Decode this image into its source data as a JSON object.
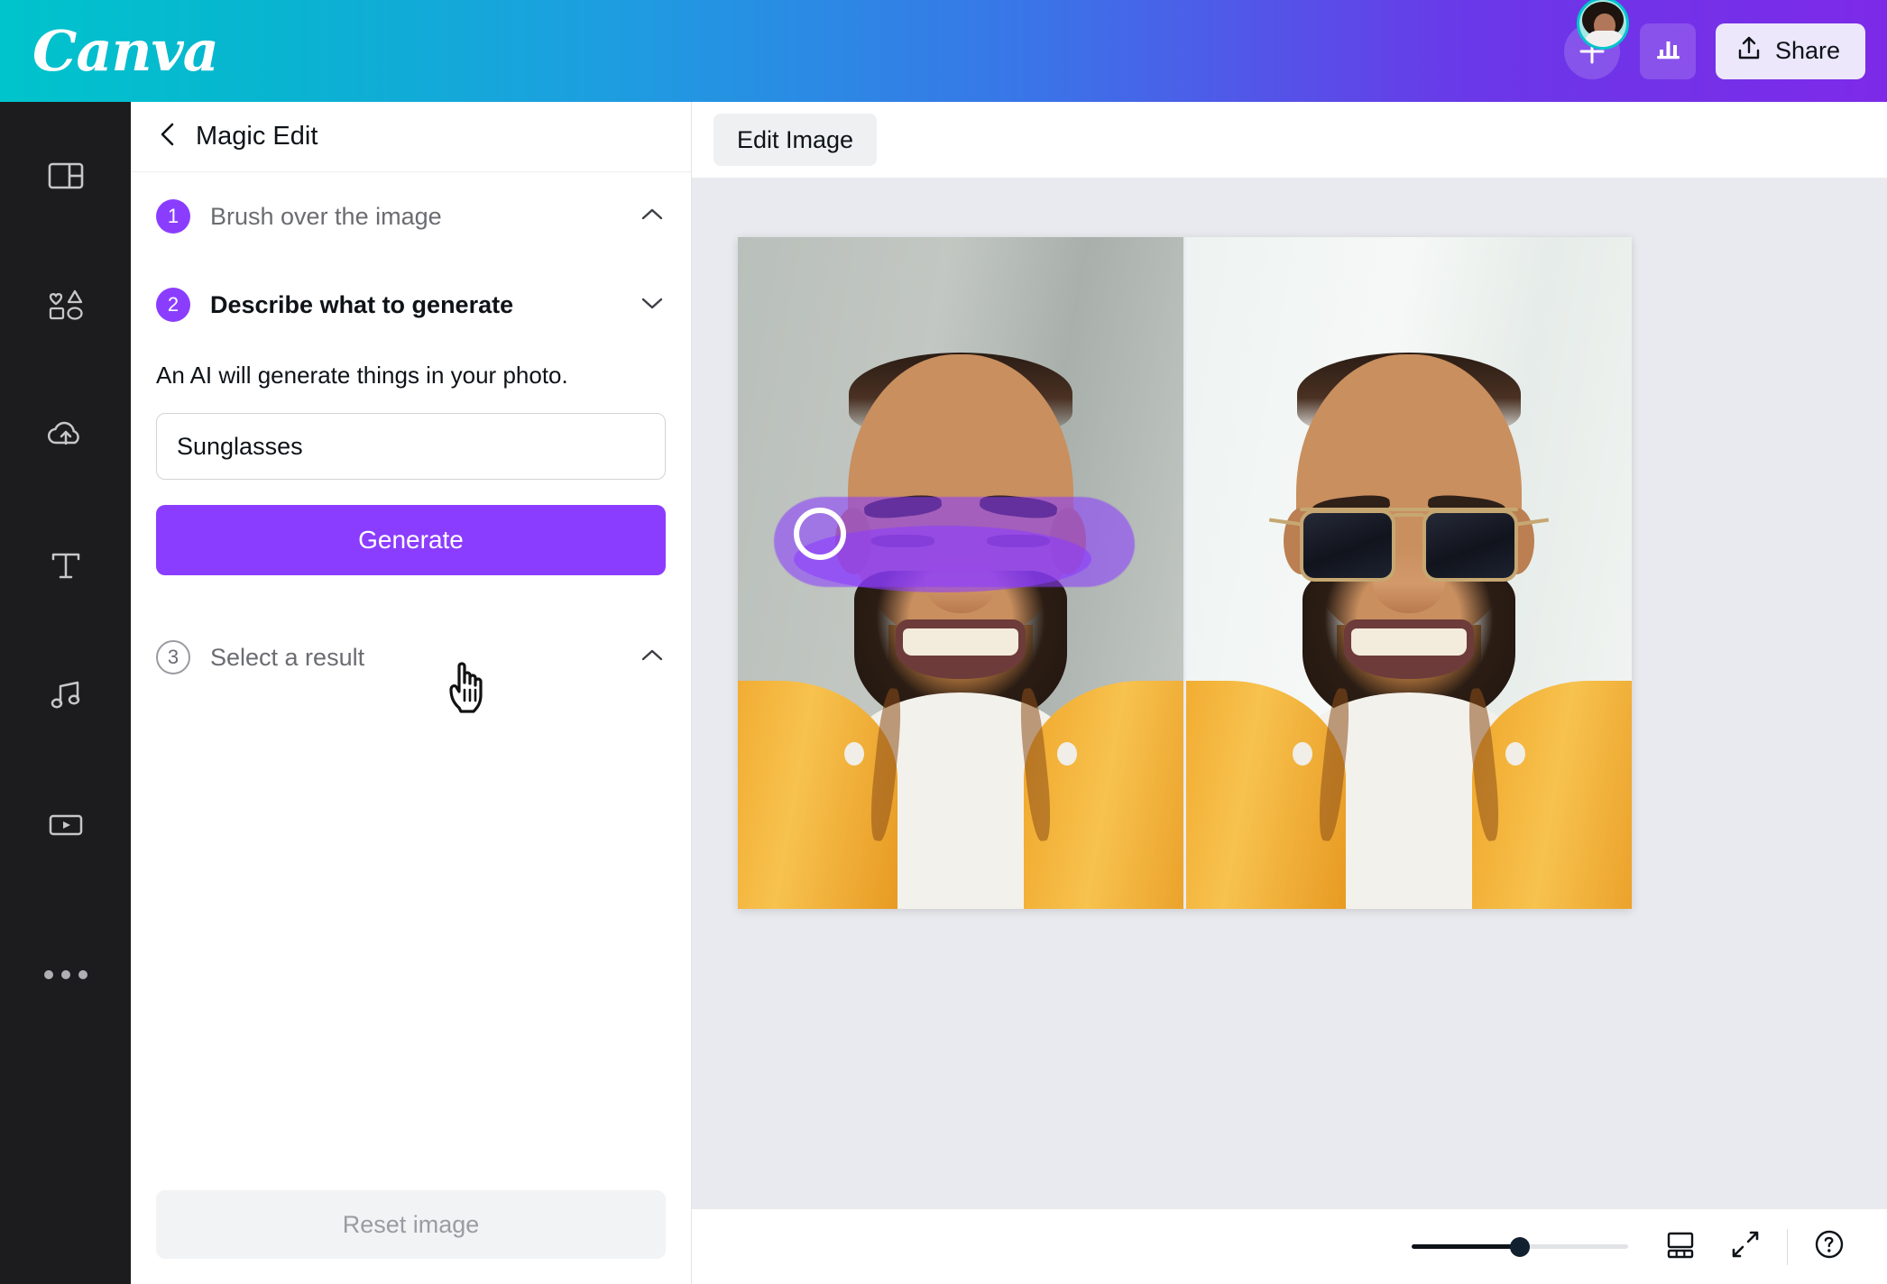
{
  "header": {
    "logo_text": "Canva",
    "gradient_start": "#00c4cc",
    "gradient_end": "#7d2ae8",
    "avatar_name": "avatar",
    "add_button_label": "+",
    "insights_icon": "bar-chart-icon",
    "share_label": "Share",
    "share_icon": "upload-icon"
  },
  "sidebar": {
    "items": [
      {
        "name": "design",
        "icon": "layout-icon"
      },
      {
        "name": "elements",
        "icon": "shapes-icon"
      },
      {
        "name": "uploads",
        "icon": "cloud-upload-icon"
      },
      {
        "name": "text",
        "icon": "text-t-icon"
      },
      {
        "name": "audio",
        "icon": "music-note-icon"
      },
      {
        "name": "videos",
        "icon": "video-play-icon"
      },
      {
        "name": "more",
        "icon": "three-dots-icon"
      }
    ]
  },
  "panel": {
    "back_icon": "chevron-left-icon",
    "title": "Magic Edit",
    "steps": [
      {
        "number": "1",
        "label": "Brush over the image",
        "state": "done",
        "chevron": "chevron-up-icon"
      },
      {
        "number": "2",
        "label": "Describe what to generate",
        "state": "active",
        "chevron": "chevron-down-icon"
      },
      {
        "number": "3",
        "label": "Select a result",
        "state": "inactive",
        "chevron": "chevron-up-icon"
      }
    ],
    "helper_text": "An AI will generate things in your photo.",
    "prompt_value": "Sunglasses",
    "prompt_placeholder": "Describe what to generate",
    "generate_label": "Generate",
    "reset_label": "Reset image",
    "accent_color": "#8b3dff"
  },
  "canvas": {
    "edit_image_label": "Edit Image",
    "stage_bg": "#e9eaef",
    "images": [
      {
        "name": "original-photo",
        "alt": "Smiling man in yellow jacket with purple brush mask over eyes",
        "brush_mask_color": "#8b3dff",
        "brush_cursor": "round-brush-cursor"
      },
      {
        "name": "result-photo",
        "alt": "Smiling man in yellow jacket wearing dark sunglasses"
      }
    ],
    "pointer_cursor": "pointing-hand-cursor"
  },
  "bottombar": {
    "zoom_percent": "50",
    "grid_icon": "pages-grid-icon",
    "fullscreen_icon": "expand-arrows-icon",
    "help_icon": "question-mark-icon"
  }
}
